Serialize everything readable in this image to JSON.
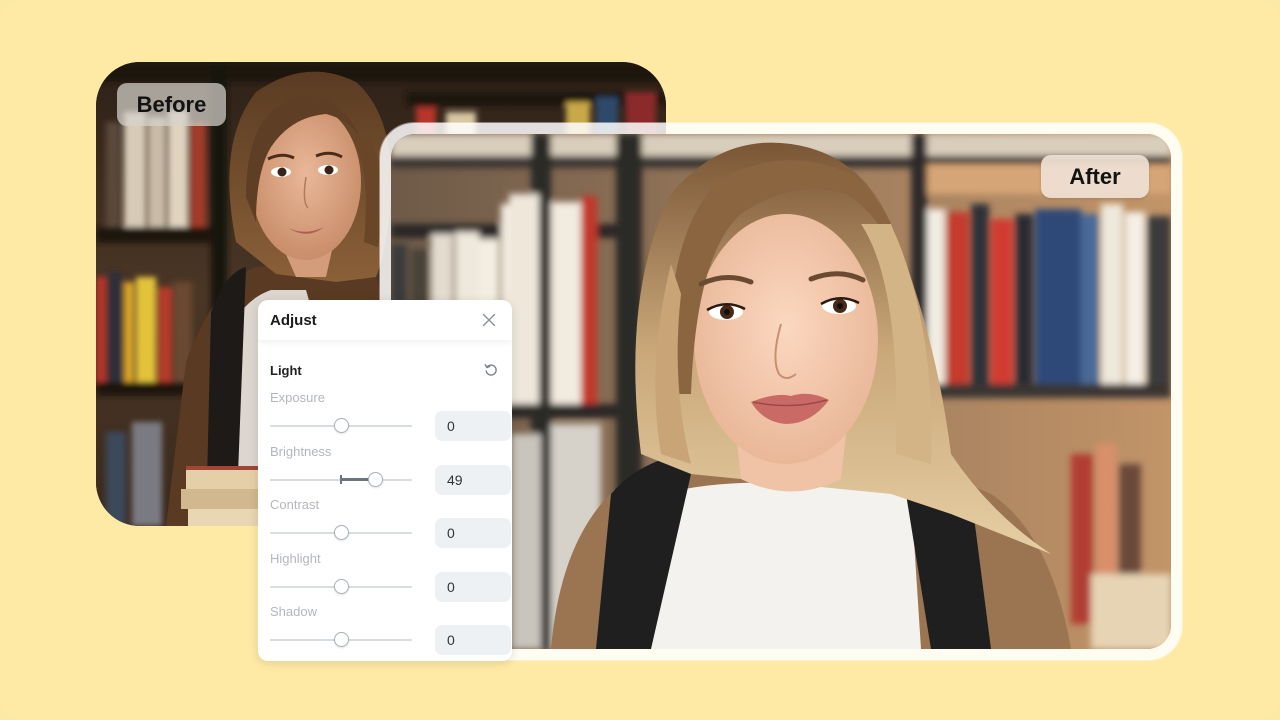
{
  "canvas": {
    "background": "#feeaa5"
  },
  "before_image": {
    "label": "Before",
    "description": "Young woman with shoulder-length brown hair in front of bookshelves, darker/warmer original photo"
  },
  "after_image": {
    "label": "After",
    "description": "Same woman, brightened photo with lighter blonde hair and brighter bookshelves"
  },
  "adjust_panel": {
    "title": "Adjust",
    "close_icon": "close-icon",
    "section": {
      "title": "Light",
      "reset_icon": "reset-icon"
    },
    "controls": [
      {
        "label": "Exposure",
        "value": "0",
        "min": -100,
        "max": 100,
        "current": 0
      },
      {
        "label": "Brightness",
        "value": "49",
        "min": -100,
        "max": 100,
        "current": 49
      },
      {
        "label": "Contrast",
        "value": "0",
        "min": -100,
        "max": 100,
        "current": 0
      },
      {
        "label": "Highlight",
        "value": "0",
        "min": -100,
        "max": 100,
        "current": 0
      },
      {
        "label": "Shadow",
        "value": "0",
        "min": -100,
        "max": 100,
        "current": 0
      }
    ]
  }
}
